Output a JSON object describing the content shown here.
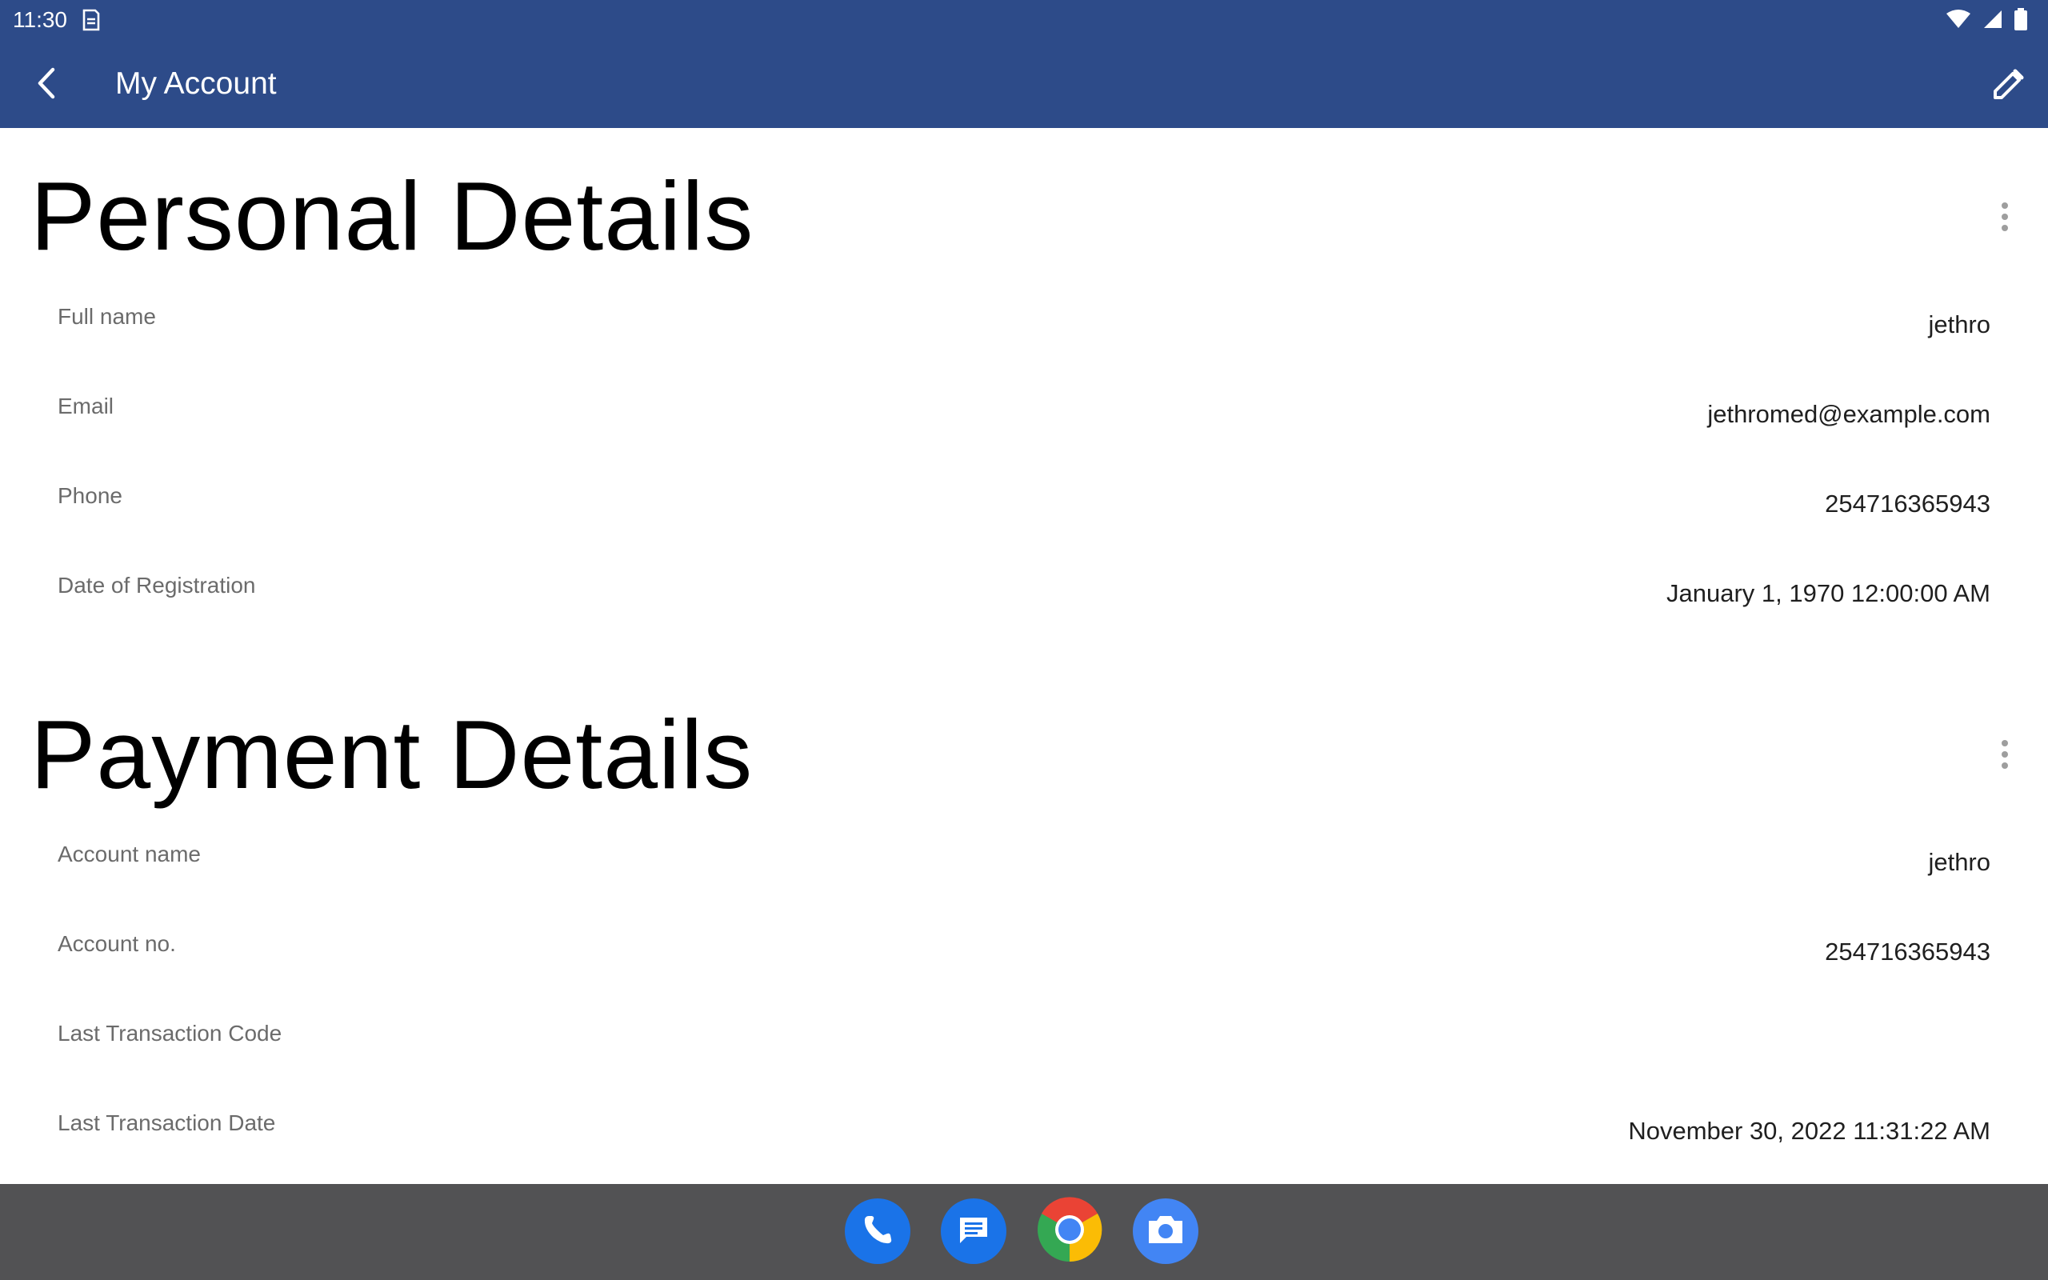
{
  "status": {
    "time": "11:30",
    "icons": [
      "sim-icon",
      "wifi-icon",
      "signal-icon",
      "battery-icon"
    ]
  },
  "appbar": {
    "title": "My Account",
    "back_icon": "chevron-left-icon",
    "edit_icon": "pencil-icon"
  },
  "personal": {
    "title": "Personal Details",
    "rows": [
      {
        "label": "Full name",
        "value": "jethro"
      },
      {
        "label": "Email",
        "value": "jethromed@example.com"
      },
      {
        "label": "Phone",
        "value": "254716365943"
      },
      {
        "label": "Date of Registration",
        "value": "January 1, 1970 12:00:00 AM"
      }
    ]
  },
  "payment": {
    "title": "Payment Details",
    "rows": [
      {
        "label": "Account name",
        "value": "jethro"
      },
      {
        "label": "Account no.",
        "value": "254716365943"
      },
      {
        "label": "Last Transaction Code",
        "value": ""
      },
      {
        "label": "Last Transaction Date",
        "value": "November 30, 2022 11:31:22 AM"
      }
    ]
  },
  "dock": {
    "apps": [
      "phone-icon",
      "messages-icon",
      "chrome-icon",
      "camera-icon"
    ]
  },
  "colors": {
    "primary": "#2d4b89",
    "navbar": "#525254",
    "label": "#6b6b6b",
    "value": "#1f1f1f"
  }
}
